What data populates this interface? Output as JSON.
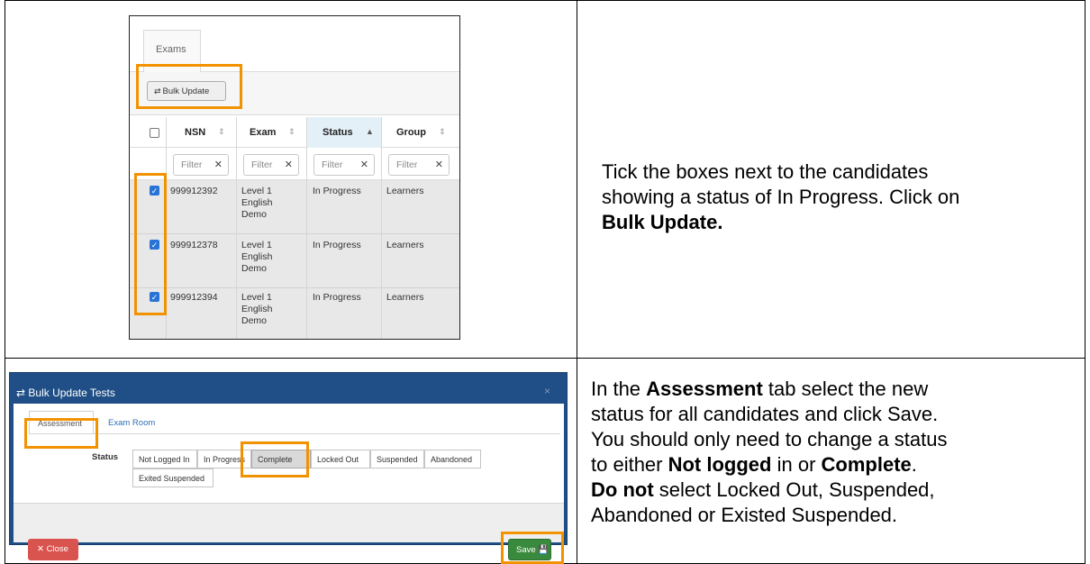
{
  "step1": {
    "screenshot": {
      "tab_label": "Exams",
      "bulk_update_button": "Bulk Update",
      "columns": [
        "NSN",
        "Exam",
        "Status",
        "Group"
      ],
      "filter_placeholder": "Filter",
      "rows": [
        {
          "nsn": "999912392",
          "exam_lines": [
            "Level 1",
            "English",
            "Demo"
          ],
          "status": "In Progress",
          "group": "Learners",
          "checked": true
        },
        {
          "nsn": "999912378",
          "exam_lines": [
            "Level 1",
            "English",
            "Demo"
          ],
          "status": "In Progress",
          "group": "Learners",
          "checked": true
        },
        {
          "nsn": "999912394",
          "exam_lines": [
            "Level 1",
            "English",
            "Demo"
          ],
          "status": "In Progress",
          "group": "Learners",
          "checked": true
        }
      ]
    },
    "instruction": {
      "line1": "Tick the boxes next to the candidates",
      "line2": "showing a status of In Progress. Click on",
      "bold": "Bulk Update."
    }
  },
  "step2": {
    "screenshot": {
      "title": "Bulk Update Tests",
      "close_x": "×",
      "tabs": [
        "Assessment",
        "Exam Room"
      ],
      "status_label": "Status",
      "options": [
        "Not Logged In",
        "In Progress",
        "Complete",
        "Locked Out",
        "Suspended",
        "Abandoned",
        "Exited Suspended"
      ],
      "selected_option": "Complete",
      "close_button": "Close",
      "save_button": "Save"
    },
    "instruction": {
      "l1_pre": "In the ",
      "l1_bold": "Assessment",
      "l1_post": " tab select the new",
      "l2": "status for all candidates and click Save.",
      "l3": "You should only need to change a status",
      "l4_pre": "to either ",
      "l4_bold1": "Not logged",
      "l4_mid": " in or ",
      "l4_bold2": "Complete",
      "l4_post": ".",
      "l5_bold": "Do not",
      "l5_post": " select Locked Out, Suspended,",
      "l6": "Abandoned or Existed Suspended."
    }
  },
  "colors": {
    "highlight": "#f39200",
    "modal_header": "#1f4f86",
    "save_green": "#3a8a3d",
    "close_red": "#d9534f",
    "checkbox_blue": "#2a73d6"
  }
}
